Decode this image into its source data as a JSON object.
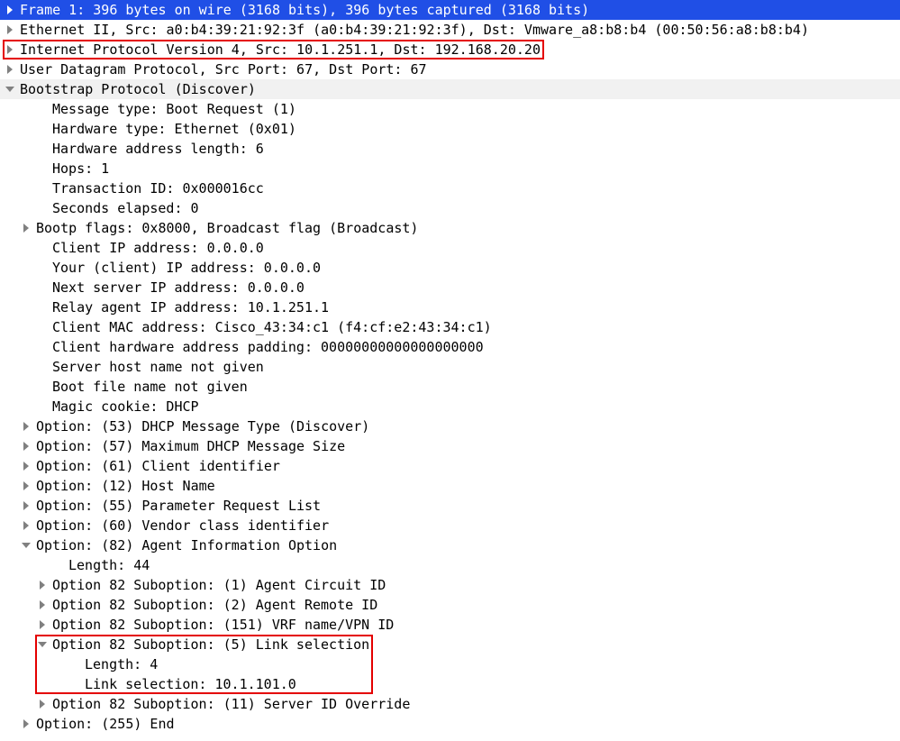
{
  "rows": [
    {
      "indent": 0,
      "arrow": "right",
      "selected": true,
      "text": "Frame 1: 396 bytes on wire (3168 bits), 396 bytes captured (3168 bits)"
    },
    {
      "indent": 0,
      "arrow": "right",
      "text": "Ethernet II, Src: a0:b4:39:21:92:3f (a0:b4:39:21:92:3f), Dst: Vmware_a8:b8:b4 (00:50:56:a8:b8:b4)"
    },
    {
      "indent": 0,
      "arrow": "right",
      "red": true,
      "text": "Internet Protocol Version 4, Src: 10.1.251.1, Dst: 192.168.20.20"
    },
    {
      "indent": 0,
      "arrow": "right",
      "text": "User Datagram Protocol, Src Port: 67, Dst Port: 67"
    },
    {
      "indent": 0,
      "arrow": "down",
      "shade": true,
      "text": "Bootstrap Protocol (Discover)"
    },
    {
      "indent": 2,
      "arrow": "none",
      "text": "Message type: Boot Request (1)"
    },
    {
      "indent": 2,
      "arrow": "none",
      "text": "Hardware type: Ethernet (0x01)"
    },
    {
      "indent": 2,
      "arrow": "none",
      "text": "Hardware address length: 6"
    },
    {
      "indent": 2,
      "arrow": "none",
      "text": "Hops: 1"
    },
    {
      "indent": 2,
      "arrow": "none",
      "text": "Transaction ID: 0x000016cc"
    },
    {
      "indent": 2,
      "arrow": "none",
      "text": "Seconds elapsed: 0"
    },
    {
      "indent": 1,
      "arrow": "right",
      "text": "Bootp flags: 0x8000, Broadcast flag (Broadcast)"
    },
    {
      "indent": 2,
      "arrow": "none",
      "text": "Client IP address: 0.0.0.0"
    },
    {
      "indent": 2,
      "arrow": "none",
      "text": "Your (client) IP address: 0.0.0.0"
    },
    {
      "indent": 2,
      "arrow": "none",
      "text": "Next server IP address: 0.0.0.0"
    },
    {
      "indent": 2,
      "arrow": "none",
      "text": "Relay agent IP address: 10.1.251.1"
    },
    {
      "indent": 2,
      "arrow": "none",
      "text": "Client MAC address: Cisco_43:34:c1 (f4:cf:e2:43:34:c1)"
    },
    {
      "indent": 2,
      "arrow": "none",
      "text": "Client hardware address padding: 00000000000000000000"
    },
    {
      "indent": 2,
      "arrow": "none",
      "text": "Server host name not given"
    },
    {
      "indent": 2,
      "arrow": "none",
      "text": "Boot file name not given"
    },
    {
      "indent": 2,
      "arrow": "none",
      "text": "Magic cookie: DHCP"
    },
    {
      "indent": 1,
      "arrow": "right",
      "text": "Option: (53) DHCP Message Type (Discover)"
    },
    {
      "indent": 1,
      "arrow": "right",
      "text": "Option: (57) Maximum DHCP Message Size"
    },
    {
      "indent": 1,
      "arrow": "right",
      "text": "Option: (61) Client identifier"
    },
    {
      "indent": 1,
      "arrow": "right",
      "text": "Option: (12) Host Name"
    },
    {
      "indent": 1,
      "arrow": "right",
      "text": "Option: (55) Parameter Request List"
    },
    {
      "indent": 1,
      "arrow": "right",
      "text": "Option: (60) Vendor class identifier"
    },
    {
      "indent": 1,
      "arrow": "down",
      "text": "Option: (82) Agent Information Option"
    },
    {
      "indent": 3,
      "arrow": "none",
      "text": "Length: 44"
    },
    {
      "indent": 2,
      "arrow": "right",
      "text": "Option 82 Suboption: (1) Agent Circuit ID"
    },
    {
      "indent": 2,
      "arrow": "right",
      "text": "Option 82 Suboption: (2) Agent Remote ID"
    },
    {
      "indent": 2,
      "arrow": "right",
      "text": "Option 82 Suboption: (151) VRF name/VPN ID"
    },
    {
      "indent": 2,
      "arrow": "down",
      "red": true,
      "text": "Option 82 Suboption: (5) Link selection"
    },
    {
      "indent": 4,
      "arrow": "none",
      "red": true,
      "text": "Length: 4"
    },
    {
      "indent": 4,
      "arrow": "none",
      "red": true,
      "text": "Link selection: 10.1.101.0"
    },
    {
      "indent": 2,
      "arrow": "right",
      "text": "Option 82 Suboption: (11) Server ID Override"
    },
    {
      "indent": 1,
      "arrow": "right",
      "text": "Option: (255) End"
    }
  ]
}
